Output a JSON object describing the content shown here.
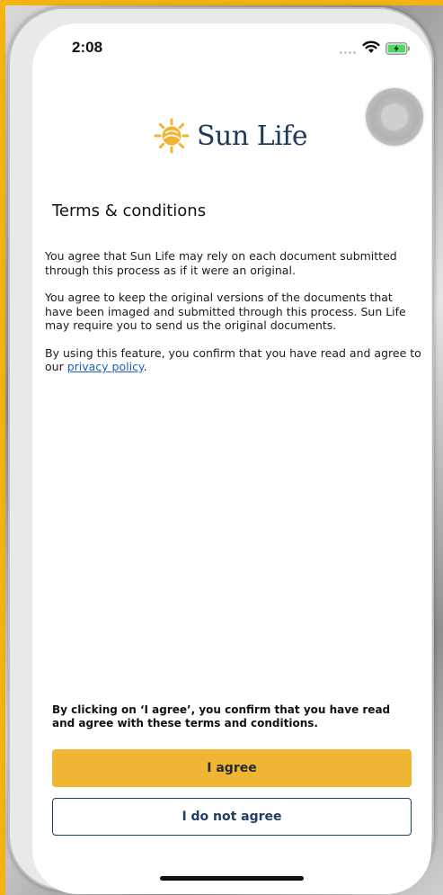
{
  "status_bar": {
    "time": "2:08",
    "icons": [
      "cellular-signal-icon",
      "wifi-icon",
      "battery-charging-icon"
    ],
    "battery_color": "#4cd964"
  },
  "header": {
    "logo_text": "Sun Life",
    "logo_colors": {
      "sun": "#f0b532",
      "text": "#1b3a5a"
    }
  },
  "page": {
    "title": "Terms & conditions",
    "paragraphs": [
      "You agree that Sun Life may rely on each document submitted through this process as if it were an original.",
      "You agree to keep the original versions of the documents that have been imaged and submitted through this process. Sun Life may require you to send us the original documents."
    ],
    "consent_prefix": "By using this feature, you confirm that you have read and agree to our ",
    "privacy_link": "privacy policy",
    "consent_suffix": "."
  },
  "footer": {
    "confirm_text": "By clicking on ‘I agree’, you confirm that you have read and agree with these terms and conditions.",
    "agree_label": "I agree",
    "disagree_label": "I do not agree"
  },
  "colors": {
    "accent": "#f0b532",
    "navy": "#1f3f63",
    "link": "#1a62b8",
    "frame": "#f2b313"
  }
}
